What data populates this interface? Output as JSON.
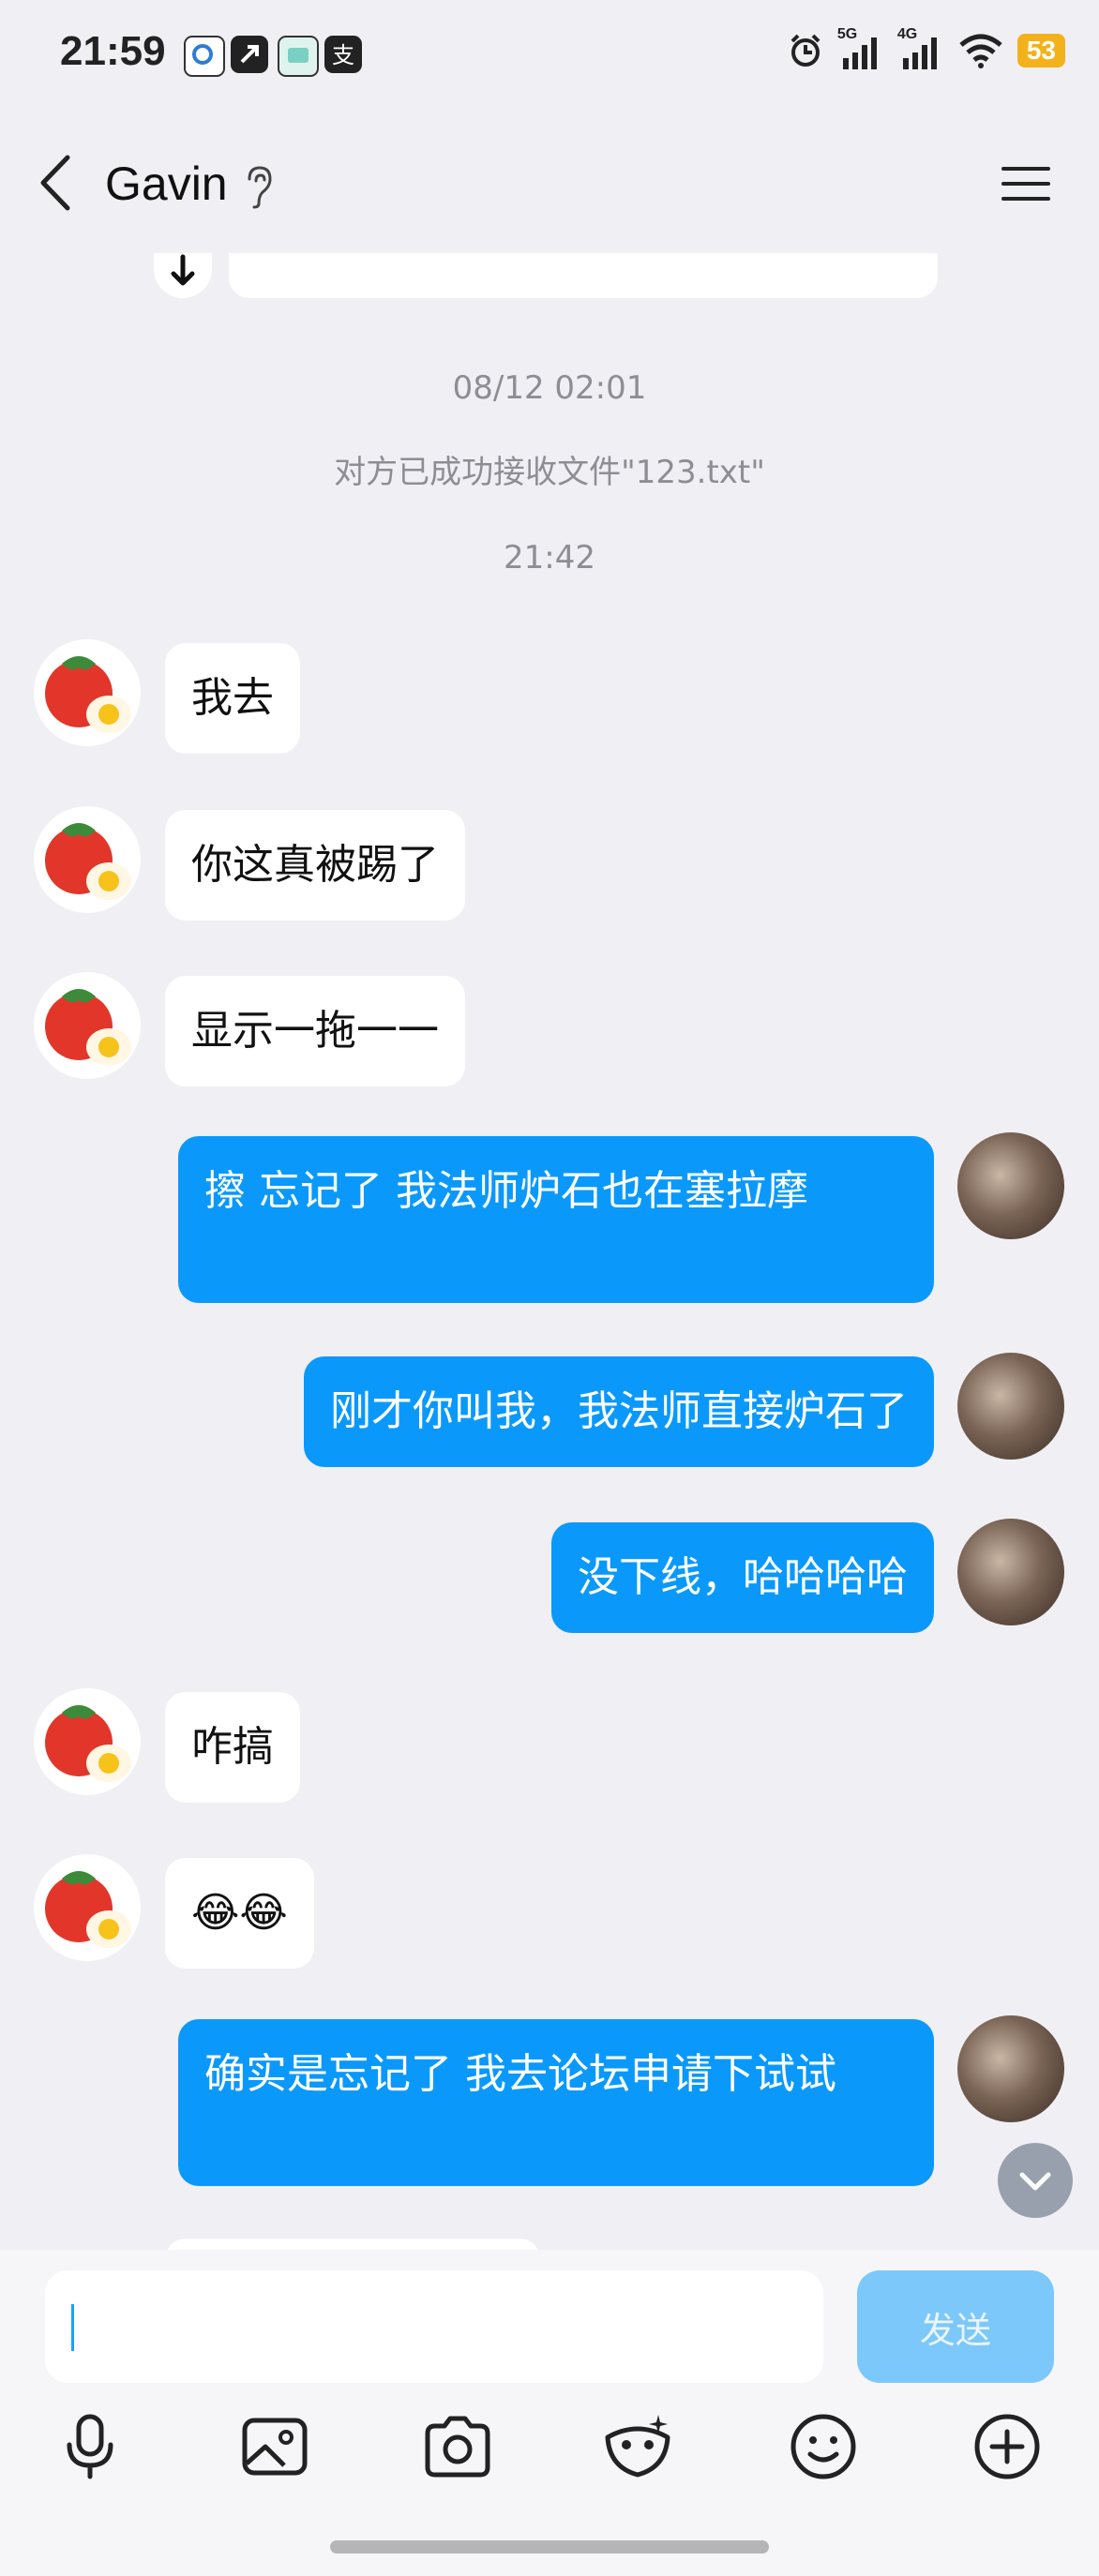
{
  "status_bar": {
    "time": "21:59",
    "signal_5g": "5G",
    "signal_4g": "4G",
    "battery": "53",
    "icons": [
      "search-app-icon",
      "shortcut-app-icon",
      "chat-app-icon",
      "alipay-icon",
      "alarm-icon",
      "signal-icon",
      "wifi-icon"
    ]
  },
  "header": {
    "title": "Gavin",
    "back_icon": "chevron-left-icon",
    "ear_icon": "ear-icon",
    "menu_icon": "hamburger-icon"
  },
  "chat": {
    "timestamp_1": "08/12 02:01",
    "system_notice": "对方已成功接收文件\"123.txt\"",
    "timestamp_2": "21:42",
    "messages": [
      {
        "side": "in",
        "text": "我去"
      },
      {
        "side": "in",
        "text": "你这真被踢了"
      },
      {
        "side": "in",
        "text": "显示一拖一一"
      },
      {
        "side": "out",
        "text": "擦  忘记了  我法师炉石也在塞拉摩"
      },
      {
        "side": "out",
        "text": "刚才你叫我，我法师直接炉石了"
      },
      {
        "side": "out",
        "text": "没下线，哈哈哈哈"
      },
      {
        "side": "in",
        "text": "咋搞"
      },
      {
        "side": "in",
        "text": "😂😂",
        "emoji": true
      },
      {
        "side": "out",
        "text": "确实是忘记了  我去论坛申请下试试"
      }
    ]
  },
  "input": {
    "placeholder": "",
    "send_label": "发送"
  },
  "toolbar": {
    "items": [
      "microphone-icon",
      "image-icon",
      "camera-icon",
      "mask-icon",
      "emoji-icon",
      "plus-icon"
    ]
  },
  "colors": {
    "background": "#f0eff4",
    "outgoing_bubble": "#0a99fb",
    "incoming_bubble": "#ffffff",
    "send_button": "#7cc8fb",
    "battery": "#f3b21b"
  }
}
